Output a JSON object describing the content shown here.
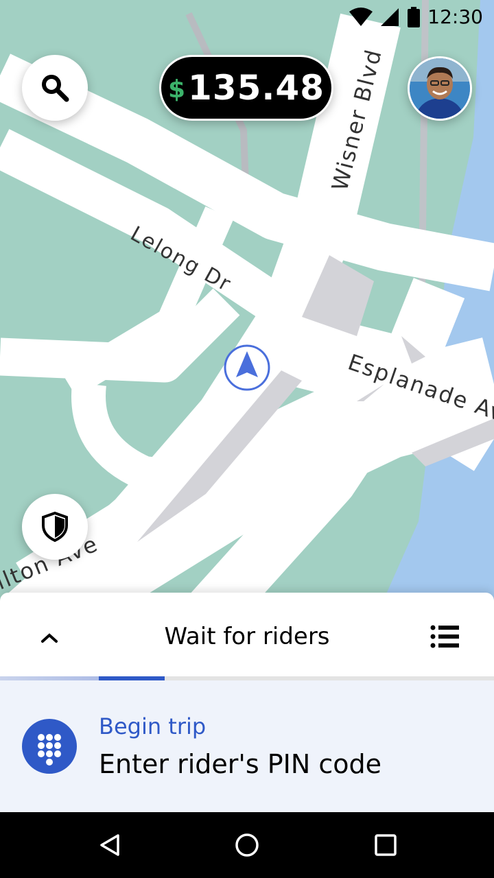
{
  "status": {
    "time": "12:30",
    "icons": [
      "wifi-icon",
      "cell-signal-icon",
      "battery-icon"
    ]
  },
  "map": {
    "streets": [
      "Wisner Blvd",
      "Lelong Dr",
      "Esplanade Av",
      "llton Ave"
    ],
    "colors": {
      "land": "#a2d0c3",
      "road": "#ffffff",
      "water": "#a3c8ee",
      "building": "#d3d3d8",
      "location": "#4a6fdc"
    }
  },
  "earnings": {
    "currency": "$",
    "amount": "135.48"
  },
  "sheet": {
    "title": "Wait for riders",
    "progress": 0.333
  },
  "pin_card": {
    "title": "Begin trip",
    "subtitle": "Enter rider's PIN code"
  },
  "colors": {
    "accent": "#2f59c7",
    "money": "#3bb26a"
  }
}
